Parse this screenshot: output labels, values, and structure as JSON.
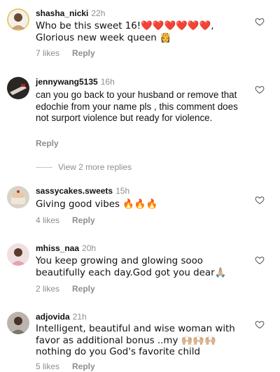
{
  "comments": [
    {
      "username": "shasha_nicki",
      "time": "22h",
      "text": "Who be this sweet 16!❤️❤️❤️❤️❤️❤️, Glorious new week queen 👸",
      "likes": "7 likes",
      "reply": "Reply",
      "avatar": "avatar-woman-white-bg"
    },
    {
      "username": "jennywang5135",
      "time": "16h",
      "text": "can you go back to your husband or remove that edochie from your name pls , this comment does not surport violence but ready for violence.",
      "likes": "",
      "reply": "Reply",
      "avatar": "avatar-dark-hand"
    },
    {
      "username": "sassycakes.sweets",
      "time": "15h",
      "text": "Giving good vibes 🔥🔥🔥",
      "likes": "4 likes",
      "reply": "Reply",
      "avatar": "avatar-cake"
    },
    {
      "username": "mhiss_naa",
      "time": "20h",
      "text": "You keep growing and glowing sooo beautifully each day.God got you dear🙏🏼",
      "likes": "2 likes",
      "reply": "Reply",
      "avatar": "avatar-woman-pink"
    },
    {
      "username": "adjovida",
      "time": "21h",
      "text": "Intelligent, beautiful and wise woman with favor as additional bonus ..my 🙌🏼🙌🏼🙌🏼 nothing do you God's favorite child",
      "likes": "5 likes",
      "reply": "Reply",
      "avatar": "avatar-woman-grey"
    }
  ],
  "view_replies": "View 2 more replies",
  "icons": {
    "like": "heart-outline-icon"
  },
  "colors": {
    "meta": "#8e8e8e",
    "text": "#111111",
    "background": "#ffffff"
  }
}
